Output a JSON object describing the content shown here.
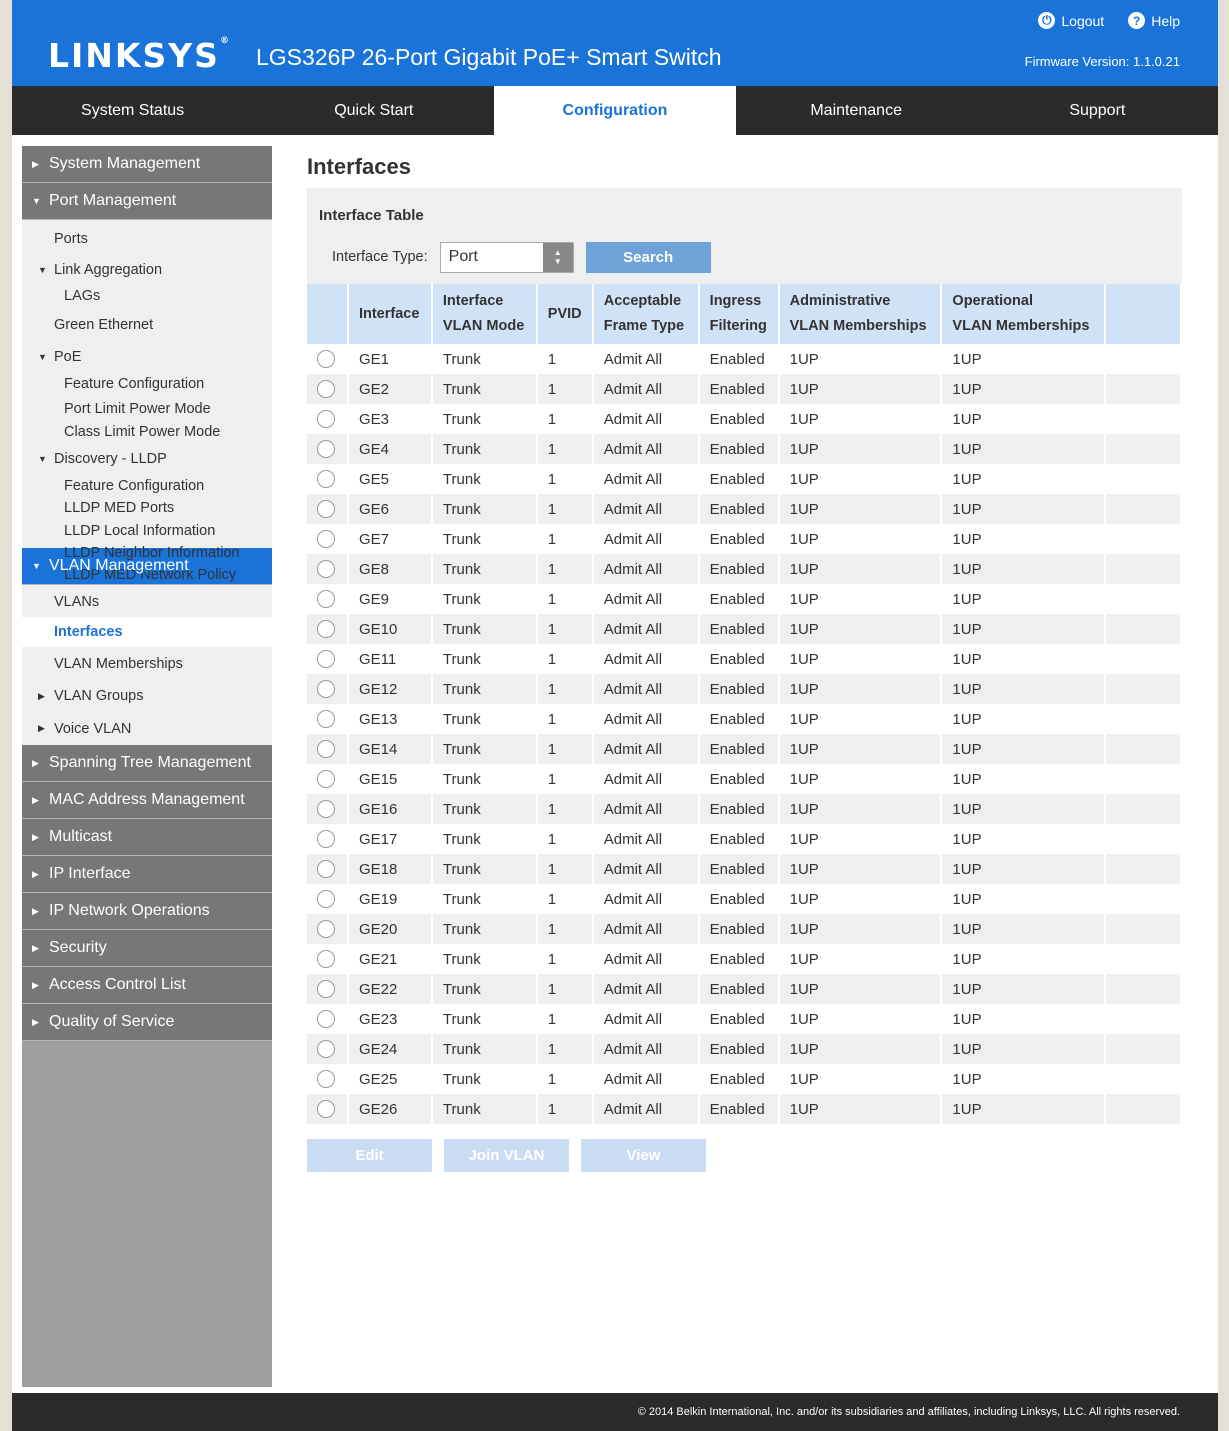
{
  "header": {
    "logo": "LINKSYS",
    "logo_mark": "®",
    "product": "LGS326P 26-Port Gigabit PoE+ Smart Switch",
    "logout": "Logout",
    "help": "Help",
    "firmware": "Firmware Version: 1.1.0.21",
    "brand_color": "#1a73d9"
  },
  "nav": {
    "tabs": [
      {
        "label": "System Status"
      },
      {
        "label": "Quick Start"
      },
      {
        "label": "Configuration"
      },
      {
        "label": "Maintenance"
      },
      {
        "label": "Support"
      }
    ],
    "active": "Configuration"
  },
  "sidebar": {
    "system_management": "System Management",
    "port_management": "Port Management",
    "ports": "Ports",
    "link_aggregation": "Link Aggregation",
    "lags": "LAGs",
    "green_ethernet": "Green Ethernet",
    "poe": "PoE",
    "poe_feature_configuration": "Feature Configuration",
    "port_limit_power_mode": "Port Limit Power Mode",
    "class_limit_power_mode": "Class Limit Power Mode",
    "discovery_lldp": "Discovery - LLDP",
    "lldp_feature_configuration": "Feature Configuration",
    "lldp_med_ports": "LLDP MED Ports",
    "lldp_local_information": "LLDP Local Information",
    "lldp_neighbor_information": "LLDP Neighbor Information",
    "lldp_med_network_policy": "LLDP MED Network Policy",
    "vlan_management": "VLAN Management",
    "vlans": "VLANs",
    "interfaces": "Interfaces",
    "vlan_memberships": "VLAN Memberships",
    "vlan_groups": "VLAN Groups",
    "voice_vlan": "Voice VLAN",
    "spanning_tree_management": "Spanning Tree Management",
    "mac_address_management": "MAC Address Management",
    "multicast": "Multicast",
    "ip_interface": "IP Interface",
    "ip_network_operations": "IP Network Operations",
    "security": "Security",
    "access_control_list": "Access Control List",
    "quality_of_service": "Quality of Service"
  },
  "main": {
    "page_title": "Interfaces",
    "table_title": "Interface Table",
    "filter_label": "Interface Type:",
    "filter_value": "Port",
    "search_label": "Search",
    "columns": [
      [
        "Interface",
        ""
      ],
      [
        "Interface",
        "VLAN Mode"
      ],
      [
        "PVID",
        ""
      ],
      [
        "Acceptable",
        "Frame Type"
      ],
      [
        "Ingress",
        "Filtering"
      ],
      [
        "Administrative",
        "VLAN Memberships"
      ],
      [
        "Operational",
        "VLAN Memberships"
      ]
    ],
    "rows": [
      [
        "GE1",
        "Trunk",
        "1",
        "Admit All",
        "Enabled",
        "1UP",
        "1UP"
      ],
      [
        "GE2",
        "Trunk",
        "1",
        "Admit All",
        "Enabled",
        "1UP",
        "1UP"
      ],
      [
        "GE3",
        "Trunk",
        "1",
        "Admit All",
        "Enabled",
        "1UP",
        "1UP"
      ],
      [
        "GE4",
        "Trunk",
        "1",
        "Admit All",
        "Enabled",
        "1UP",
        "1UP"
      ],
      [
        "GE5",
        "Trunk",
        "1",
        "Admit All",
        "Enabled",
        "1UP",
        "1UP"
      ],
      [
        "GE6",
        "Trunk",
        "1",
        "Admit All",
        "Enabled",
        "1UP",
        "1UP"
      ],
      [
        "GE7",
        "Trunk",
        "1",
        "Admit All",
        "Enabled",
        "1UP",
        "1UP"
      ],
      [
        "GE8",
        "Trunk",
        "1",
        "Admit All",
        "Enabled",
        "1UP",
        "1UP"
      ],
      [
        "GE9",
        "Trunk",
        "1",
        "Admit All",
        "Enabled",
        "1UP",
        "1UP"
      ],
      [
        "GE10",
        "Trunk",
        "1",
        "Admit All",
        "Enabled",
        "1UP",
        "1UP"
      ],
      [
        "GE11",
        "Trunk",
        "1",
        "Admit All",
        "Enabled",
        "1UP",
        "1UP"
      ],
      [
        "GE12",
        "Trunk",
        "1",
        "Admit All",
        "Enabled",
        "1UP",
        "1UP"
      ],
      [
        "GE13",
        "Trunk",
        "1",
        "Admit All",
        "Enabled",
        "1UP",
        "1UP"
      ],
      [
        "GE14",
        "Trunk",
        "1",
        "Admit All",
        "Enabled",
        "1UP",
        "1UP"
      ],
      [
        "GE15",
        "Trunk",
        "1",
        "Admit All",
        "Enabled",
        "1UP",
        "1UP"
      ],
      [
        "GE16",
        "Trunk",
        "1",
        "Admit All",
        "Enabled",
        "1UP",
        "1UP"
      ],
      [
        "GE17",
        "Trunk",
        "1",
        "Admit All",
        "Enabled",
        "1UP",
        "1UP"
      ],
      [
        "GE18",
        "Trunk",
        "1",
        "Admit All",
        "Enabled",
        "1UP",
        "1UP"
      ],
      [
        "GE19",
        "Trunk",
        "1",
        "Admit All",
        "Enabled",
        "1UP",
        "1UP"
      ],
      [
        "GE20",
        "Trunk",
        "1",
        "Admit All",
        "Enabled",
        "1UP",
        "1UP"
      ],
      [
        "GE21",
        "Trunk",
        "1",
        "Admit All",
        "Enabled",
        "1UP",
        "1UP"
      ],
      [
        "GE22",
        "Trunk",
        "1",
        "Admit All",
        "Enabled",
        "1UP",
        "1UP"
      ],
      [
        "GE23",
        "Trunk",
        "1",
        "Admit All",
        "Enabled",
        "1UP",
        "1UP"
      ],
      [
        "GE24",
        "Trunk",
        "1",
        "Admit All",
        "Enabled",
        "1UP",
        "1UP"
      ],
      [
        "GE25",
        "Trunk",
        "1",
        "Admit All",
        "Enabled",
        "1UP",
        "1UP"
      ],
      [
        "GE26",
        "Trunk",
        "1",
        "Admit All",
        "Enabled",
        "1UP",
        "1UP"
      ]
    ],
    "buttons": {
      "edit": "Edit",
      "join_vlan": "Join VLAN",
      "view": "View"
    }
  },
  "footer": {
    "copyright": "© 2014 Belkin International, Inc. and/or its subsidiaries and affiliates, including Linksys, LLC. All rights reserved."
  }
}
